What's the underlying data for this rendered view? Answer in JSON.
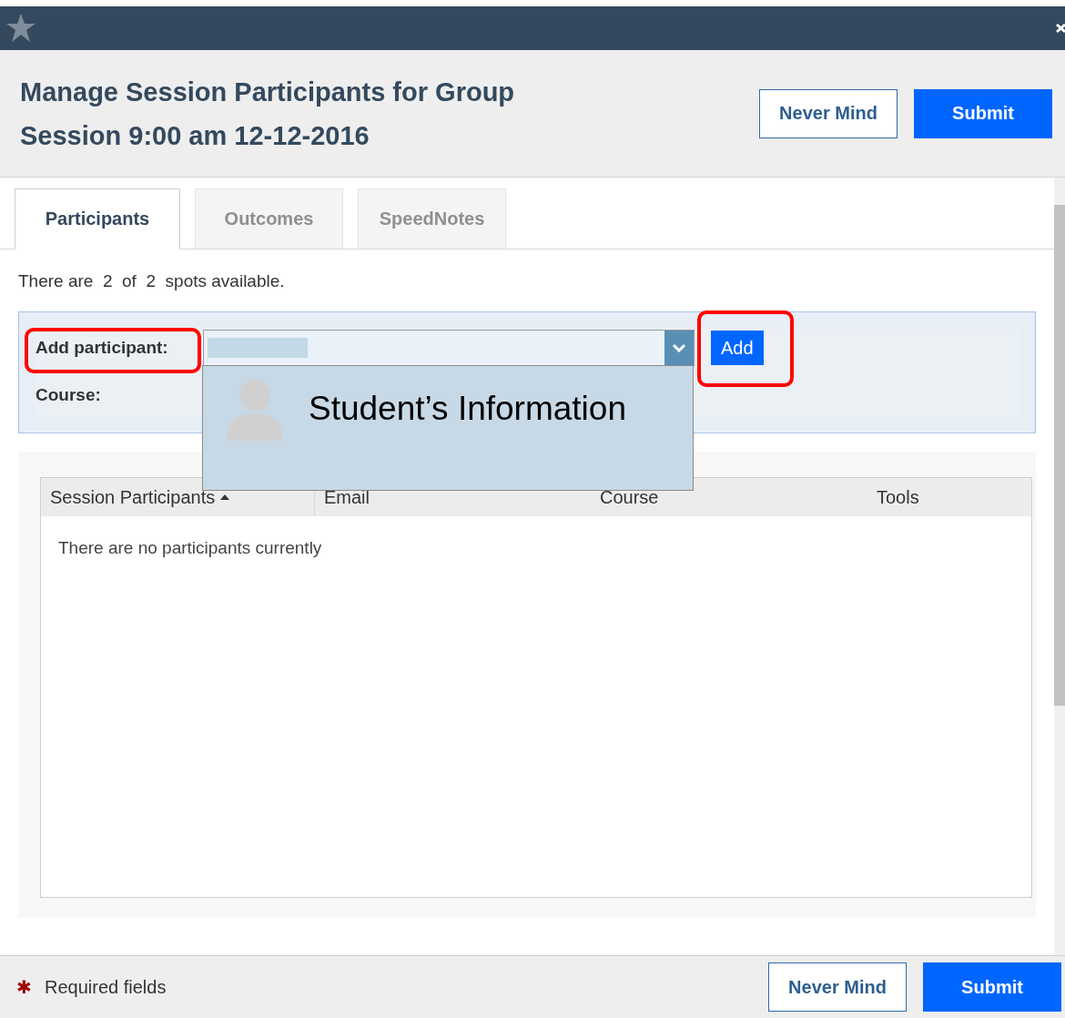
{
  "header": {
    "title_lines": [
      "Manage Session Participants for Group",
      "Session 9:00 am 12-12-2016"
    ],
    "buttons": [
      {
        "label": "Never Mind",
        "kind": "secondary"
      },
      {
        "label": "Submit",
        "kind": "primary"
      }
    ]
  },
  "tabs": [
    {
      "label": "Participants",
      "selected": true
    },
    {
      "label": "Outcomes",
      "selected": false
    },
    {
      "label": "SpeedNotes",
      "selected": false
    }
  ],
  "availability": "There are  2  of  2  spots available.",
  "form": {
    "add_label": "Add participant:",
    "course_label": "Course:",
    "add_button": "Add",
    "dropdown_option": "Student’s Information",
    "highlighted": true
  },
  "table": {
    "columns": [
      {
        "label": "Session Participants",
        "sorted": true
      },
      {
        "label": "Email",
        "sorted": false
      },
      {
        "label": "Course",
        "sorted": false
      },
      {
        "label": "Tools",
        "sorted": false
      }
    ],
    "empty_message": "There are no participants currently"
  },
  "footer": {
    "required_mark": "✱",
    "required_text": "Required fields",
    "buttons": [
      {
        "label": "Never Mind",
        "kind": "secondary"
      },
      {
        "label": "Submit",
        "kind": "primary"
      }
    ]
  }
}
